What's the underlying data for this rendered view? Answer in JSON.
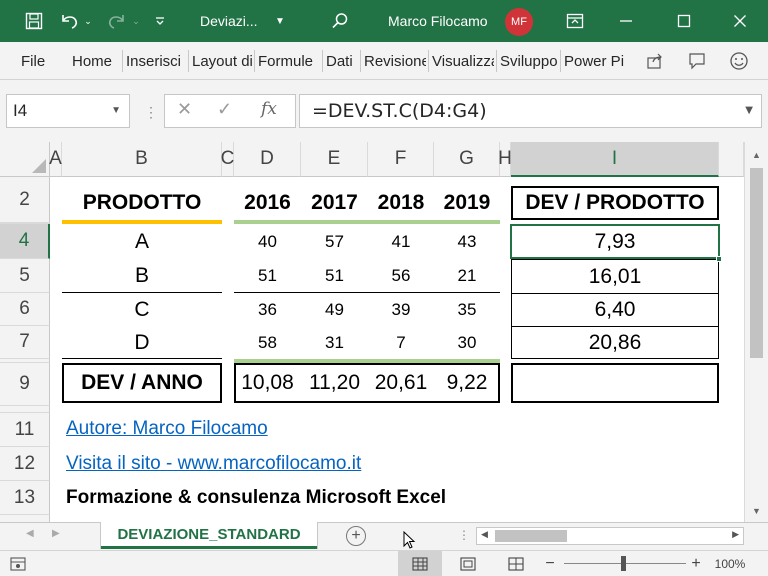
{
  "title_bar": {
    "doc_name": "Deviazi...",
    "user_name": "Marco Filocamo",
    "user_initials": "MF"
  },
  "ribbon": {
    "tabs": [
      "File",
      "Home",
      "Inserisci",
      "Layout di pagina",
      "Formule",
      "Dati",
      "Revisione",
      "Visualizza",
      "Sviluppo",
      "Power Pivot"
    ]
  },
  "formula_bar": {
    "name_box": "I4",
    "fx_label": "fx",
    "formula": "=DEV.ST.C(D4:G4)"
  },
  "columns": [
    "A",
    "B",
    "C",
    "D",
    "E",
    "F",
    "G",
    "H",
    "I"
  ],
  "rows": [
    "2",
    "4",
    "5",
    "6",
    "7",
    "9",
    "11",
    "12",
    "13"
  ],
  "table": {
    "product_header": "PRODOTTO",
    "years": [
      "2016",
      "2017",
      "2018",
      "2019"
    ],
    "dev_product_header": "DEV / PRODOTTO",
    "products": [
      {
        "name": "A",
        "values": [
          "40",
          "57",
          "41",
          "43"
        ],
        "dev": "7,93"
      },
      {
        "name": "B",
        "values": [
          "51",
          "51",
          "56",
          "21"
        ],
        "dev": "16,01"
      },
      {
        "name": "C",
        "values": [
          "36",
          "49",
          "39",
          "35"
        ],
        "dev": "6,40"
      },
      {
        "name": "D",
        "values": [
          "58",
          "31",
          "7",
          "30"
        ],
        "dev": "20,86"
      }
    ],
    "dev_year_label": "DEV / ANNO",
    "dev_year_values": [
      "10,08",
      "11,20",
      "20,61",
      "9,22"
    ]
  },
  "footer_text": {
    "author_link": "Autore: Marco Filocamo",
    "site_link": "Visita il sito - www.marcofilocamo.it",
    "tagline": "Formazione & consulenza Microsoft Excel"
  },
  "sheet_tabs": {
    "active": "DEVIAZIONE_STANDARD"
  },
  "status_bar": {
    "zoom": "100%"
  },
  "colors": {
    "excel_green": "#217346",
    "orange_accent": "#ffc000",
    "green_accent": "#a9d08e",
    "link_blue": "#0563c1"
  }
}
